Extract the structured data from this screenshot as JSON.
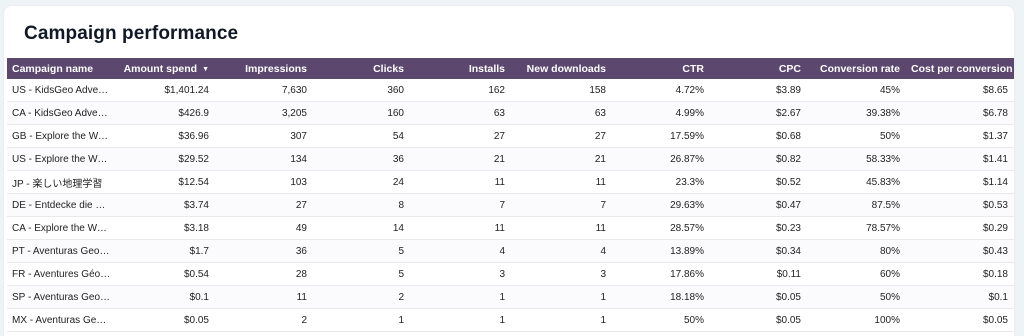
{
  "title": "Campaign performance",
  "columns": [
    {
      "label": "Campaign name",
      "align": "left"
    },
    {
      "label": "Amount spend",
      "align": "right",
      "sort": "desc"
    },
    {
      "label": "Impressions",
      "align": "right"
    },
    {
      "label": "Clicks",
      "align": "right"
    },
    {
      "label": "Installs",
      "align": "right"
    },
    {
      "label": "New downloads",
      "align": "right"
    },
    {
      "label": "CTR",
      "align": "right"
    },
    {
      "label": "CPC",
      "align": "right"
    },
    {
      "label": "Conversion rate",
      "align": "right"
    },
    {
      "label": "Cost per conversion",
      "align": "right"
    }
  ],
  "sort_icon": "triangle-down-icon",
  "header_color": "#5c476f",
  "rows": [
    [
      "US - KidsGeo Adventures",
      "$1,401.24",
      "7,630",
      "360",
      "162",
      "158",
      "4.72%",
      "$3.89",
      "45%",
      "$8.65"
    ],
    [
      "CA - KidsGeo Adventures",
      "$426.9",
      "3,205",
      "160",
      "63",
      "63",
      "4.99%",
      "$2.67",
      "39.38%",
      "$6.78"
    ],
    [
      "GB - Explore the World",
      "$36.96",
      "307",
      "54",
      "27",
      "27",
      "17.59%",
      "$0.68",
      "50%",
      "$1.37"
    ],
    [
      "US - Explore the World",
      "$29.52",
      "134",
      "36",
      "21",
      "21",
      "26.87%",
      "$0.82",
      "58.33%",
      "$1.41"
    ],
    [
      "JP - 楽しい地理学習",
      "$12.54",
      "103",
      "24",
      "11",
      "11",
      "23.3%",
      "$0.52",
      "45.83%",
      "$1.14"
    ],
    [
      "DE - Entdecke die Welt",
      "$3.74",
      "27",
      "8",
      "7",
      "7",
      "29.63%",
      "$0.47",
      "87.5%",
      "$0.53"
    ],
    [
      "CA - Explore the World",
      "$3.18",
      "49",
      "14",
      "11",
      "11",
      "28.57%",
      "$0.23",
      "78.57%",
      "$0.29"
    ],
    [
      "PT - Aventuras Geográficas",
      "$1.7",
      "36",
      "5",
      "4",
      "4",
      "13.89%",
      "$0.34",
      "80%",
      "$0.43"
    ],
    [
      "FR - Aventures Géographiques",
      "$0.54",
      "28",
      "5",
      "3",
      "3",
      "17.86%",
      "$0.11",
      "60%",
      "$0.18"
    ],
    [
      "SP - Aventuras Geográficas",
      "$0.1",
      "11",
      "2",
      "1",
      "1",
      "18.18%",
      "$0.05",
      "50%",
      "$0.1"
    ],
    [
      "MX - Aventuras Geográficas",
      "$0.05",
      "2",
      "1",
      "1",
      "1",
      "50%",
      "$0.05",
      "100%",
      "$0.05"
    ]
  ]
}
